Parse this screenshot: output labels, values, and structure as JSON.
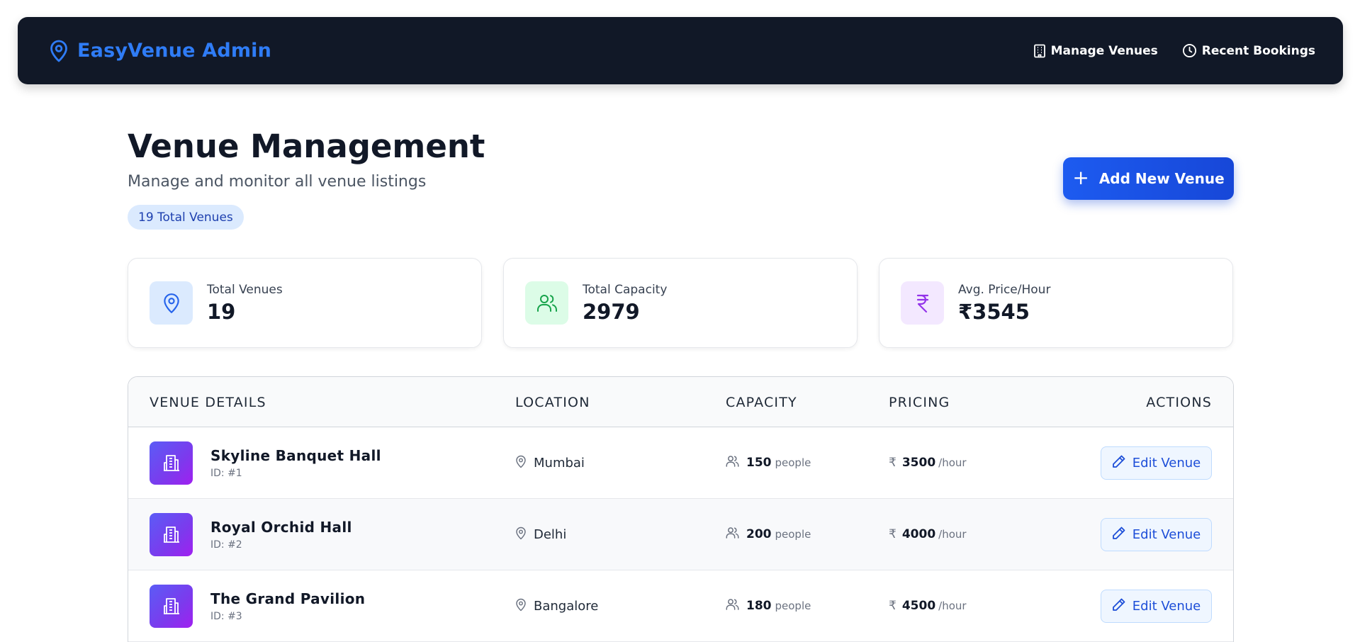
{
  "navbar": {
    "brand": "EasyVenue Admin",
    "links": [
      {
        "label": "Manage Venues",
        "icon": "building-icon"
      },
      {
        "label": "Recent Bookings",
        "icon": "clock-icon"
      }
    ]
  },
  "header": {
    "title": "Venue Management",
    "subtitle": "Manage and monitor all venue listings",
    "badge": "19 Total Venues",
    "add_button": "Add New Venue"
  },
  "stats": [
    {
      "label": "Total Venues",
      "value": "19",
      "icon": "map-pin-icon",
      "icon_bg": "#dbeafe",
      "icon_color": "#2563eb"
    },
    {
      "label": "Total Capacity",
      "value": "2979",
      "icon": "users-icon",
      "icon_bg": "#dcfce7",
      "icon_color": "#16a34a"
    },
    {
      "label": "Avg. Price/Hour",
      "value": "₹3545",
      "icon": "rupee-icon",
      "icon_bg": "#f3e8ff",
      "icon_color": "#9333ea"
    }
  ],
  "table": {
    "columns": [
      "VENUE DETAILS",
      "LOCATION",
      "CAPACITY",
      "PRICING",
      "ACTIONS"
    ],
    "rows": [
      {
        "name": "Skyline Banquet Hall",
        "id": "ID: #1",
        "location": "Mumbai",
        "capacity": "150",
        "capacity_unit": "people",
        "price": "3500",
        "price_unit": "/hour",
        "action": "Edit Venue"
      },
      {
        "name": "Royal Orchid Hall",
        "id": "ID: #2",
        "location": "Delhi",
        "capacity": "200",
        "capacity_unit": "people",
        "price": "4000",
        "price_unit": "/hour",
        "action": "Edit Venue"
      },
      {
        "name": "The Grand Pavilion",
        "id": "ID: #3",
        "location": "Bangalore",
        "capacity": "180",
        "capacity_unit": "people",
        "price": "4500",
        "price_unit": "/hour",
        "action": "Edit Venue"
      }
    ],
    "price_symbol": "₹"
  },
  "colors": {
    "navbar_bg": "#111827",
    "brand": "#2f7cf6",
    "primary": "#1d5bf0",
    "venue_icon_gradient": [
      "#5b5cf6",
      "#a020f0"
    ]
  }
}
